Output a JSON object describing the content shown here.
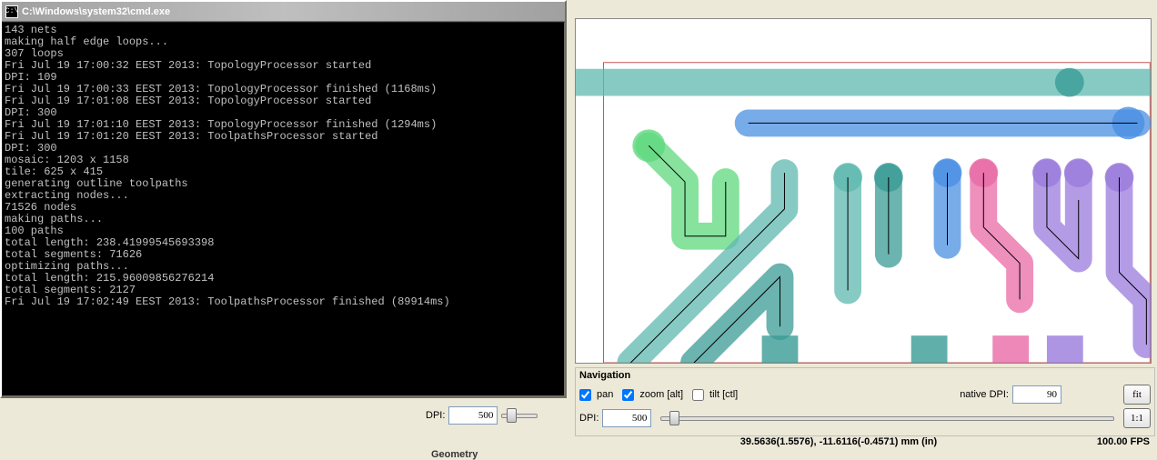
{
  "console": {
    "title": "C:\\Windows\\system32\\cmd.exe",
    "icon_text": "C:\\",
    "lines": [
      "143 nets",
      "making half edge loops...",
      "307 loops",
      "Fri Jul 19 17:00:32 EEST 2013: TopologyProcessor started",
      "DPI: 109",
      "Fri Jul 19 17:00:33 EEST 2013: TopologyProcessor finished (1168ms)",
      "Fri Jul 19 17:01:08 EEST 2013: TopologyProcessor started",
      "DPI: 300",
      "Fri Jul 19 17:01:10 EEST 2013: TopologyProcessor finished (1294ms)",
      "Fri Jul 19 17:01:20 EEST 2013: ToolpathsProcessor started",
      "DPI: 300",
      "mosaic: 1203 x 1158",
      "tile: 625 x 415",
      "generating outline toolpaths",
      "extracting nodes...",
      "71526 nodes",
      "making paths...",
      "100 paths",
      "total length: 238.41999545693398",
      "total segments: 71626",
      "optimizing paths...",
      "total length: 215.96009856276214",
      "total segments: 2127",
      "Fri Jul 19 17:02:49 EEST 2013: ToolpathsProcessor finished (89914ms)"
    ]
  },
  "left_bar": {
    "dpi_label": "DPI:",
    "dpi_value": "500",
    "geometry_label": "Geometry"
  },
  "navigation": {
    "title": "Navigation",
    "pan": {
      "label": "pan",
      "checked": true
    },
    "zoom": {
      "label": "zoom [alt]",
      "checked": true
    },
    "tilt": {
      "label": "tilt [ctl]",
      "checked": false
    },
    "native_dpi_label": "native DPI:",
    "native_dpi_value": "90",
    "fit_label": "fit",
    "dpi_label": "DPI:",
    "dpi_value": "500",
    "oneone_label": "1:1"
  },
  "status": {
    "coords": "39.5636(1.5576), -11.6116(-0.4571) mm (in)",
    "fps": "100.00 FPS"
  },
  "pcb_colors": {
    "green": "#5fd87e",
    "teal": "#5fb8b0",
    "blue": "#4a90e2",
    "purple": "#9a7bdc",
    "pink": "#e86aa6",
    "darkteal": "#3a9b96"
  }
}
